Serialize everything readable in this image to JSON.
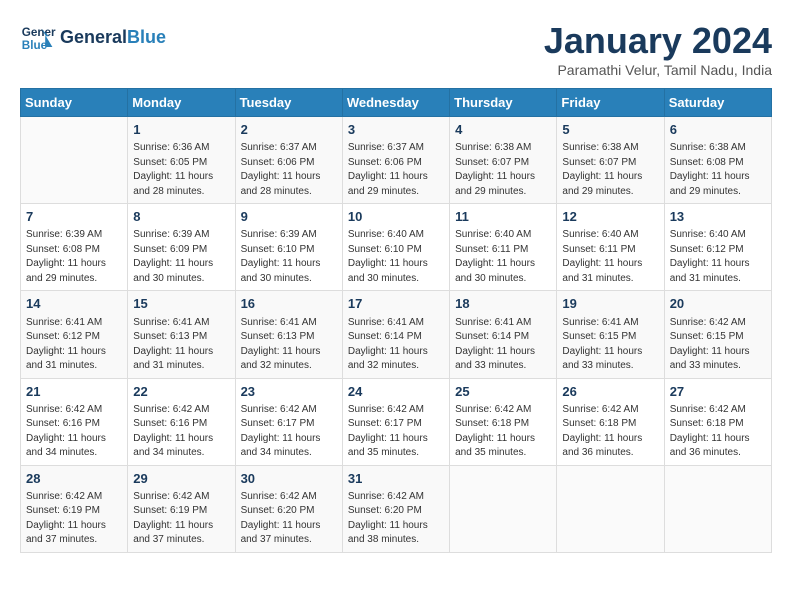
{
  "header": {
    "logo_line1": "General",
    "logo_line2": "Blue",
    "title": "January 2024",
    "subtitle": "Paramathi Velur, Tamil Nadu, India"
  },
  "weekdays": [
    "Sunday",
    "Monday",
    "Tuesday",
    "Wednesday",
    "Thursday",
    "Friday",
    "Saturday"
  ],
  "weeks": [
    [
      {
        "day": "",
        "sunrise": "",
        "sunset": "",
        "daylight": ""
      },
      {
        "day": "1",
        "sunrise": "Sunrise: 6:36 AM",
        "sunset": "Sunset: 6:05 PM",
        "daylight": "Daylight: 11 hours and 28 minutes."
      },
      {
        "day": "2",
        "sunrise": "Sunrise: 6:37 AM",
        "sunset": "Sunset: 6:06 PM",
        "daylight": "Daylight: 11 hours and 28 minutes."
      },
      {
        "day": "3",
        "sunrise": "Sunrise: 6:37 AM",
        "sunset": "Sunset: 6:06 PM",
        "daylight": "Daylight: 11 hours and 29 minutes."
      },
      {
        "day": "4",
        "sunrise": "Sunrise: 6:38 AM",
        "sunset": "Sunset: 6:07 PM",
        "daylight": "Daylight: 11 hours and 29 minutes."
      },
      {
        "day": "5",
        "sunrise": "Sunrise: 6:38 AM",
        "sunset": "Sunset: 6:07 PM",
        "daylight": "Daylight: 11 hours and 29 minutes."
      },
      {
        "day": "6",
        "sunrise": "Sunrise: 6:38 AM",
        "sunset": "Sunset: 6:08 PM",
        "daylight": "Daylight: 11 hours and 29 minutes."
      }
    ],
    [
      {
        "day": "7",
        "sunrise": "Sunrise: 6:39 AM",
        "sunset": "Sunset: 6:08 PM",
        "daylight": "Daylight: 11 hours and 29 minutes."
      },
      {
        "day": "8",
        "sunrise": "Sunrise: 6:39 AM",
        "sunset": "Sunset: 6:09 PM",
        "daylight": "Daylight: 11 hours and 30 minutes."
      },
      {
        "day": "9",
        "sunrise": "Sunrise: 6:39 AM",
        "sunset": "Sunset: 6:10 PM",
        "daylight": "Daylight: 11 hours and 30 minutes."
      },
      {
        "day": "10",
        "sunrise": "Sunrise: 6:40 AM",
        "sunset": "Sunset: 6:10 PM",
        "daylight": "Daylight: 11 hours and 30 minutes."
      },
      {
        "day": "11",
        "sunrise": "Sunrise: 6:40 AM",
        "sunset": "Sunset: 6:11 PM",
        "daylight": "Daylight: 11 hours and 30 minutes."
      },
      {
        "day": "12",
        "sunrise": "Sunrise: 6:40 AM",
        "sunset": "Sunset: 6:11 PM",
        "daylight": "Daylight: 11 hours and 31 minutes."
      },
      {
        "day": "13",
        "sunrise": "Sunrise: 6:40 AM",
        "sunset": "Sunset: 6:12 PM",
        "daylight": "Daylight: 11 hours and 31 minutes."
      }
    ],
    [
      {
        "day": "14",
        "sunrise": "Sunrise: 6:41 AM",
        "sunset": "Sunset: 6:12 PM",
        "daylight": "Daylight: 11 hours and 31 minutes."
      },
      {
        "day": "15",
        "sunrise": "Sunrise: 6:41 AM",
        "sunset": "Sunset: 6:13 PM",
        "daylight": "Daylight: 11 hours and 31 minutes."
      },
      {
        "day": "16",
        "sunrise": "Sunrise: 6:41 AM",
        "sunset": "Sunset: 6:13 PM",
        "daylight": "Daylight: 11 hours and 32 minutes."
      },
      {
        "day": "17",
        "sunrise": "Sunrise: 6:41 AM",
        "sunset": "Sunset: 6:14 PM",
        "daylight": "Daylight: 11 hours and 32 minutes."
      },
      {
        "day": "18",
        "sunrise": "Sunrise: 6:41 AM",
        "sunset": "Sunset: 6:14 PM",
        "daylight": "Daylight: 11 hours and 33 minutes."
      },
      {
        "day": "19",
        "sunrise": "Sunrise: 6:41 AM",
        "sunset": "Sunset: 6:15 PM",
        "daylight": "Daylight: 11 hours and 33 minutes."
      },
      {
        "day": "20",
        "sunrise": "Sunrise: 6:42 AM",
        "sunset": "Sunset: 6:15 PM",
        "daylight": "Daylight: 11 hours and 33 minutes."
      }
    ],
    [
      {
        "day": "21",
        "sunrise": "Sunrise: 6:42 AM",
        "sunset": "Sunset: 6:16 PM",
        "daylight": "Daylight: 11 hours and 34 minutes."
      },
      {
        "day": "22",
        "sunrise": "Sunrise: 6:42 AM",
        "sunset": "Sunset: 6:16 PM",
        "daylight": "Daylight: 11 hours and 34 minutes."
      },
      {
        "day": "23",
        "sunrise": "Sunrise: 6:42 AM",
        "sunset": "Sunset: 6:17 PM",
        "daylight": "Daylight: 11 hours and 34 minutes."
      },
      {
        "day": "24",
        "sunrise": "Sunrise: 6:42 AM",
        "sunset": "Sunset: 6:17 PM",
        "daylight": "Daylight: 11 hours and 35 minutes."
      },
      {
        "day": "25",
        "sunrise": "Sunrise: 6:42 AM",
        "sunset": "Sunset: 6:18 PM",
        "daylight": "Daylight: 11 hours and 35 minutes."
      },
      {
        "day": "26",
        "sunrise": "Sunrise: 6:42 AM",
        "sunset": "Sunset: 6:18 PM",
        "daylight": "Daylight: 11 hours and 36 minutes."
      },
      {
        "day": "27",
        "sunrise": "Sunrise: 6:42 AM",
        "sunset": "Sunset: 6:18 PM",
        "daylight": "Daylight: 11 hours and 36 minutes."
      }
    ],
    [
      {
        "day": "28",
        "sunrise": "Sunrise: 6:42 AM",
        "sunset": "Sunset: 6:19 PM",
        "daylight": "Daylight: 11 hours and 37 minutes."
      },
      {
        "day": "29",
        "sunrise": "Sunrise: 6:42 AM",
        "sunset": "Sunset: 6:19 PM",
        "daylight": "Daylight: 11 hours and 37 minutes."
      },
      {
        "day": "30",
        "sunrise": "Sunrise: 6:42 AM",
        "sunset": "Sunset: 6:20 PM",
        "daylight": "Daylight: 11 hours and 37 minutes."
      },
      {
        "day": "31",
        "sunrise": "Sunrise: 6:42 AM",
        "sunset": "Sunset: 6:20 PM",
        "daylight": "Daylight: 11 hours and 38 minutes."
      },
      {
        "day": "",
        "sunrise": "",
        "sunset": "",
        "daylight": ""
      },
      {
        "day": "",
        "sunrise": "",
        "sunset": "",
        "daylight": ""
      },
      {
        "day": "",
        "sunrise": "",
        "sunset": "",
        "daylight": ""
      }
    ]
  ]
}
